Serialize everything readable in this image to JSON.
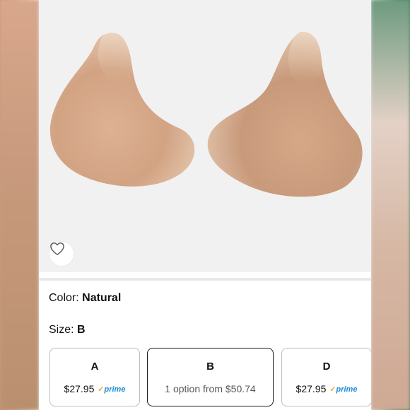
{
  "product": {
    "image_alt": "silicone breast forms pair",
    "wishlist_icon": "heart-icon"
  },
  "color": {
    "label": "Color:",
    "value": "Natural"
  },
  "size": {
    "label": "Size:",
    "value": "B",
    "options": [
      {
        "letter": "A",
        "price": "$27.95",
        "prime": "prime",
        "selected": false
      },
      {
        "letter": "B",
        "price": "1 option from $50.74",
        "prime": "",
        "selected": true
      },
      {
        "letter": "D",
        "price": "$27.95",
        "prime": "prime",
        "selected": false
      }
    ]
  },
  "colors": {
    "prime_blue": "#1f8ad6",
    "prime_check": "#f0a52a",
    "text": "#0f1111",
    "muted": "#565959"
  }
}
